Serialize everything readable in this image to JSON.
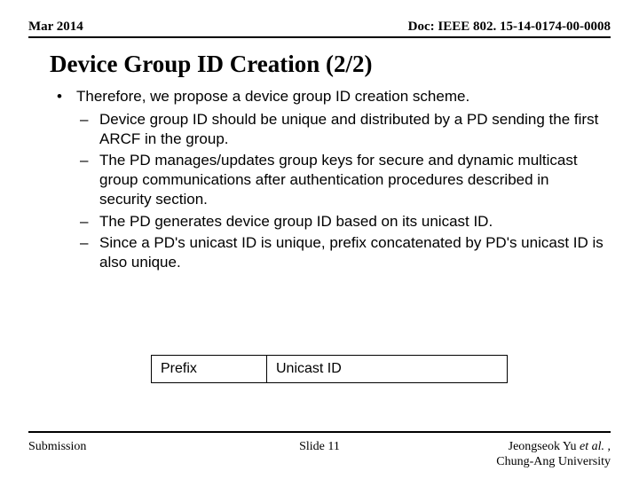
{
  "header": {
    "date": "Mar 2014",
    "doc": "Doc: IEEE 802. 15-14-0174-00-0008"
  },
  "title": "Device Group ID Creation (2/2)",
  "main_bullet": "Therefore, we propose a device group ID creation scheme.",
  "subs": [
    "Device group ID should be unique and distributed by a PD sending the first ARCF in the group.",
    "The PD manages/updates group keys for secure and dynamic multicast group communications after authentication procedures described in security section.",
    "The PD generates device group ID based on its unicast ID.",
    "Since a PD's unicast ID is unique, prefix concatenated by PD's unicast ID is also unique."
  ],
  "diagram": {
    "prefix": "Prefix",
    "unicast": "Unicast ID"
  },
  "footer": {
    "left": "Submission",
    "center": "Slide 11",
    "author_before": "Jeongseok Yu ",
    "author_ital": "et al.",
    "author_after": " ,",
    "affiliation": "Chung-Ang University"
  }
}
